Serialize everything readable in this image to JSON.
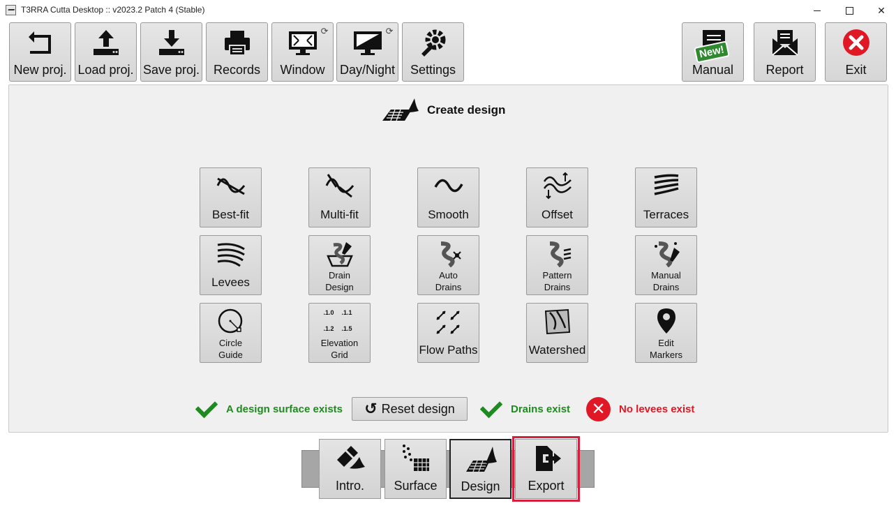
{
  "window": {
    "title": "T3RRA Cutta Desktop :: v2023.2 Patch 4 (Stable)",
    "controls": {
      "minimize": "—",
      "maximize": "□",
      "close": "✕"
    }
  },
  "toolbar": {
    "new_project": "New proj.",
    "load_project": "Load proj.",
    "save_project": "Save proj.",
    "records": "Records",
    "window": "Window",
    "day_night": "Day/Night",
    "settings": "Settings",
    "manual": "Manual",
    "manual_badge": "New!",
    "report": "Report",
    "exit": "Exit"
  },
  "panel": {
    "title": "Create design",
    "buttons": {
      "best_fit": "Best-fit",
      "multi_fit": "Multi-fit",
      "smooth": "Smooth",
      "offset": "Offset",
      "terraces": "Terraces",
      "levees": "Levees",
      "drain_design": "Drain\nDesign",
      "auto_drains": "Auto\nDrains",
      "pattern_drains": "Pattern\nDrains",
      "manual_drains": "Manual\nDrains",
      "circle_guide": "Circle\nGuide",
      "elevation_grid": "Elevation\nGrid",
      "flow_paths": "Flow Paths",
      "watershed": "Watershed",
      "edit_markers": "Edit\nMarkers"
    },
    "elevation_grid_values": [
      ".1.0",
      ".1.1",
      ".1.2",
      ".1.5"
    ]
  },
  "status": {
    "design_surface": "A design surface exists",
    "reset_design": "Reset design",
    "drains": "Drains exist",
    "levees": "No levees exist"
  },
  "nav": {
    "intro": "Intro.",
    "surface": "Surface",
    "design": "Design",
    "export": "Export"
  },
  "colors": {
    "ok_green": "#1f8a1f",
    "error_red": "#e01825",
    "highlight_red": "#d61f3a",
    "manual_badge_green": "#2f8a2f"
  }
}
